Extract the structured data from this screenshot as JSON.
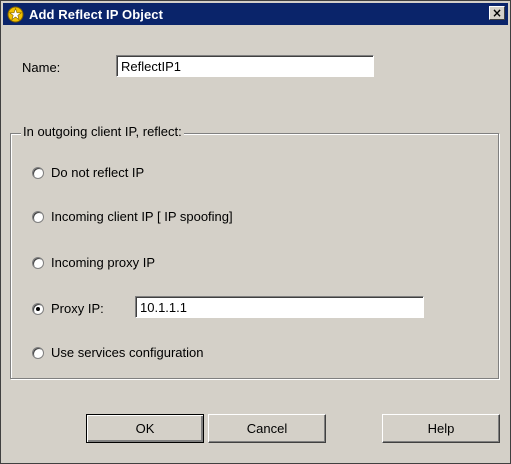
{
  "dialog": {
    "title": "Add Reflect IP Object",
    "close_label": "×"
  },
  "name_field": {
    "label": "Name:",
    "value": "ReflectIP1"
  },
  "reflect_group": {
    "legend": "In outgoing client IP, reflect:",
    "options": [
      {
        "label": "Do not reflect IP",
        "checked": false
      },
      {
        "label": "Incoming client IP [ IP spoofing]",
        "checked": false
      },
      {
        "label": "Incoming proxy IP",
        "checked": false
      },
      {
        "label": "Proxy IP:",
        "checked": true
      },
      {
        "label": "Use services configuration",
        "checked": false
      }
    ],
    "proxy_ip_value": "10.1.1.1"
  },
  "buttons": {
    "ok": "OK",
    "cancel": "Cancel",
    "help": "Help"
  },
  "colors": {
    "titlebar": "#0a246a",
    "face": "#d4d0c8",
    "icon": "#f0c000"
  }
}
